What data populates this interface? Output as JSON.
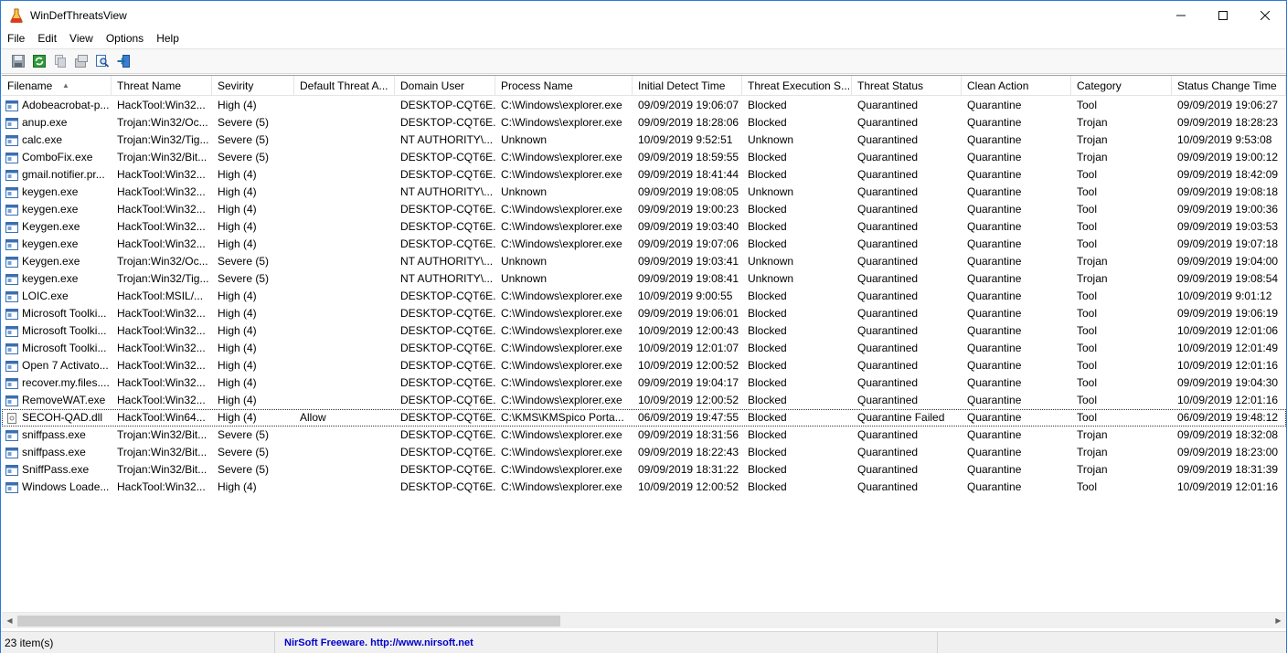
{
  "window": {
    "title": "WinDefThreatsView"
  },
  "menu": [
    "File",
    "Edit",
    "View",
    "Options",
    "Help"
  ],
  "toolbar": [
    {
      "name": "save-icon"
    },
    {
      "name": "refresh-icon"
    },
    {
      "name": "copy-icon"
    },
    {
      "name": "properties-icon"
    },
    {
      "name": "find-icon"
    },
    {
      "name": "exit-icon"
    }
  ],
  "table": {
    "columns": [
      "Filename",
      "Threat Name",
      "Sevirity",
      "Default Threat A...",
      "Domain User",
      "Process Name",
      "Initial Detect Time",
      "Threat Execution S...",
      "Threat Status",
      "Clean Action",
      "Category",
      "Status Change Time"
    ],
    "rows": [
      [
        "Adobeacrobat-p...",
        "HackTool:Win32...",
        "High (4)",
        "",
        "DESKTOP-CQT6E...",
        "C:\\Windows\\explorer.exe",
        "09/09/2019 19:06:07",
        "Blocked",
        "Quarantined",
        "Quarantine",
        "Tool",
        "09/09/2019 19:06:27"
      ],
      [
        "anup.exe",
        "Trojan:Win32/Oc...",
        "Severe (5)",
        "",
        "DESKTOP-CQT6E...",
        "C:\\Windows\\explorer.exe",
        "09/09/2019 18:28:06",
        "Blocked",
        "Quarantined",
        "Quarantine",
        "Trojan",
        "09/09/2019 18:28:23"
      ],
      [
        "calc.exe",
        "Trojan:Win32/Tig...",
        "Severe (5)",
        "",
        "NT AUTHORITY\\...",
        "Unknown",
        "10/09/2019 9:52:51",
        "Unknown",
        "Quarantined",
        "Quarantine",
        "Trojan",
        "10/09/2019 9:53:08"
      ],
      [
        "ComboFix.exe",
        "Trojan:Win32/Bit...",
        "Severe (5)",
        "",
        "DESKTOP-CQT6E...",
        "C:\\Windows\\explorer.exe",
        "09/09/2019 18:59:55",
        "Blocked",
        "Quarantined",
        "Quarantine",
        "Trojan",
        "09/09/2019 19:00:12"
      ],
      [
        "gmail.notifier.pr...",
        "HackTool:Win32...",
        "High (4)",
        "",
        "DESKTOP-CQT6E...",
        "C:\\Windows\\explorer.exe",
        "09/09/2019 18:41:44",
        "Blocked",
        "Quarantined",
        "Quarantine",
        "Tool",
        "09/09/2019 18:42:09"
      ],
      [
        "keygen.exe",
        "HackTool:Win32...",
        "High (4)",
        "",
        "NT AUTHORITY\\...",
        "Unknown",
        "09/09/2019 19:08:05",
        "Unknown",
        "Quarantined",
        "Quarantine",
        "Tool",
        "09/09/2019 19:08:18"
      ],
      [
        "keygen.exe",
        "HackTool:Win32...",
        "High (4)",
        "",
        "DESKTOP-CQT6E...",
        "C:\\Windows\\explorer.exe",
        "09/09/2019 19:00:23",
        "Blocked",
        "Quarantined",
        "Quarantine",
        "Tool",
        "09/09/2019 19:00:36"
      ],
      [
        "Keygen.exe",
        "HackTool:Win32...",
        "High (4)",
        "",
        "DESKTOP-CQT6E...",
        "C:\\Windows\\explorer.exe",
        "09/09/2019 19:03:40",
        "Blocked",
        "Quarantined",
        "Quarantine",
        "Tool",
        "09/09/2019 19:03:53"
      ],
      [
        "keygen.exe",
        "HackTool:Win32...",
        "High (4)",
        "",
        "DESKTOP-CQT6E...",
        "C:\\Windows\\explorer.exe",
        "09/09/2019 19:07:06",
        "Blocked",
        "Quarantined",
        "Quarantine",
        "Tool",
        "09/09/2019 19:07:18"
      ],
      [
        "Keygen.exe",
        "Trojan:Win32/Oc...",
        "Severe (5)",
        "",
        "NT AUTHORITY\\...",
        "Unknown",
        "09/09/2019 19:03:41",
        "Unknown",
        "Quarantined",
        "Quarantine",
        "Trojan",
        "09/09/2019 19:04:00"
      ],
      [
        "keygen.exe",
        "Trojan:Win32/Tig...",
        "Severe (5)",
        "",
        "NT AUTHORITY\\...",
        "Unknown",
        "09/09/2019 19:08:41",
        "Unknown",
        "Quarantined",
        "Quarantine",
        "Trojan",
        "09/09/2019 19:08:54"
      ],
      [
        "LOIC.exe",
        "HackTool:MSIL/...",
        "High (4)",
        "",
        "DESKTOP-CQT6E...",
        "C:\\Windows\\explorer.exe",
        "10/09/2019 9:00:55",
        "Blocked",
        "Quarantined",
        "Quarantine",
        "Tool",
        "10/09/2019 9:01:12"
      ],
      [
        "Microsoft Toolki...",
        "HackTool:Win32...",
        "High (4)",
        "",
        "DESKTOP-CQT6E...",
        "C:\\Windows\\explorer.exe",
        "09/09/2019 19:06:01",
        "Blocked",
        "Quarantined",
        "Quarantine",
        "Tool",
        "09/09/2019 19:06:19"
      ],
      [
        "Microsoft Toolki...",
        "HackTool:Win32...",
        "High (4)",
        "",
        "DESKTOP-CQT6E...",
        "C:\\Windows\\explorer.exe",
        "10/09/2019 12:00:43",
        "Blocked",
        "Quarantined",
        "Quarantine",
        "Tool",
        "10/09/2019 12:01:06"
      ],
      [
        "Microsoft Toolki...",
        "HackTool:Win32...",
        "High (4)",
        "",
        "DESKTOP-CQT6E...",
        "C:\\Windows\\explorer.exe",
        "10/09/2019 12:01:07",
        "Blocked",
        "Quarantined",
        "Quarantine",
        "Tool",
        "10/09/2019 12:01:49"
      ],
      [
        "Open 7 Activato...",
        "HackTool:Win32...",
        "High (4)",
        "",
        "DESKTOP-CQT6E...",
        "C:\\Windows\\explorer.exe",
        "10/09/2019 12:00:52",
        "Blocked",
        "Quarantined",
        "Quarantine",
        "Tool",
        "10/09/2019 12:01:16"
      ],
      [
        "recover.my.files....",
        "HackTool:Win32...",
        "High (4)",
        "",
        "DESKTOP-CQT6E...",
        "C:\\Windows\\explorer.exe",
        "09/09/2019 19:04:17",
        "Blocked",
        "Quarantined",
        "Quarantine",
        "Tool",
        "09/09/2019 19:04:30"
      ],
      [
        "RemoveWAT.exe",
        "HackTool:Win32...",
        "High (4)",
        "",
        "DESKTOP-CQT6E...",
        "C:\\Windows\\explorer.exe",
        "10/09/2019 12:00:52",
        "Blocked",
        "Quarantined",
        "Quarantine",
        "Tool",
        "10/09/2019 12:01:16"
      ],
      [
        "SECOH-QAD.dll",
        "HackTool:Win64...",
        "High (4)",
        "Allow",
        "DESKTOP-CQT6E...",
        "C:\\KMS\\KMSpico Porta...",
        "06/09/2019 19:47:55",
        "Blocked",
        "Quarantine Failed",
        "Quarantine",
        "Tool",
        "06/09/2019 19:48:12"
      ],
      [
        "sniffpass.exe",
        "Trojan:Win32/Bit...",
        "Severe (5)",
        "",
        "DESKTOP-CQT6E...",
        "C:\\Windows\\explorer.exe",
        "09/09/2019 18:31:56",
        "Blocked",
        "Quarantined",
        "Quarantine",
        "Trojan",
        "09/09/2019 18:32:08"
      ],
      [
        "sniffpass.exe",
        "Trojan:Win32/Bit...",
        "Severe (5)",
        "",
        "DESKTOP-CQT6E...",
        "C:\\Windows\\explorer.exe",
        "09/09/2019 18:22:43",
        "Blocked",
        "Quarantined",
        "Quarantine",
        "Trojan",
        "09/09/2019 18:23:00"
      ],
      [
        "SniffPass.exe",
        "Trojan:Win32/Bit...",
        "Severe (5)",
        "",
        "DESKTOP-CQT6E...",
        "C:\\Windows\\explorer.exe",
        "09/09/2019 18:31:22",
        "Blocked",
        "Quarantined",
        "Quarantine",
        "Trojan",
        "09/09/2019 18:31:39"
      ],
      [
        "Windows Loade...",
        "HackTool:Win32...",
        "High (4)",
        "",
        "DESKTOP-CQT6E...",
        "C:\\Windows\\explorer.exe",
        "10/09/2019 12:00:52",
        "Blocked",
        "Quarantined",
        "Quarantine",
        "Tool",
        "10/09/2019 12:01:16"
      ]
    ],
    "focused_row": 18,
    "sort_indicator": "▲"
  },
  "status": {
    "count": "23 item(s)",
    "link": "NirSoft Freeware.  http://www.nirsoft.net"
  },
  "colors": {
    "accent": "#2b79d8",
    "link": "#0000cc"
  }
}
